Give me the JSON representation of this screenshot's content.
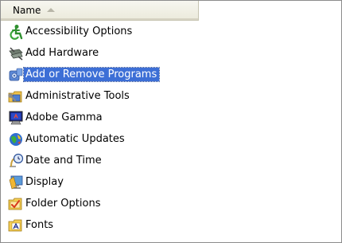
{
  "header": {
    "name_label": "Name"
  },
  "items": [
    {
      "label": "Accessibility Options",
      "icon": "accessibility-icon"
    },
    {
      "label": "Add Hardware",
      "icon": "add-hardware-icon"
    },
    {
      "label": "Add or Remove Programs",
      "icon": "add-remove-programs-icon",
      "selected": true
    },
    {
      "label": "Administrative Tools",
      "icon": "administrative-tools-icon"
    },
    {
      "label": "Adobe Gamma",
      "icon": "monitor-icon"
    },
    {
      "label": "Automatic Updates",
      "icon": "globe-icon"
    },
    {
      "label": "Date and Time",
      "icon": "clock-icon"
    },
    {
      "label": "Display",
      "icon": "display-icon"
    },
    {
      "label": "Folder Options",
      "icon": "folder-options-icon"
    },
    {
      "label": "Fonts",
      "icon": "fonts-folder-icon"
    }
  ],
  "colors": {
    "selection": "#3d6fd6",
    "header_bg": "#ebeadb"
  }
}
